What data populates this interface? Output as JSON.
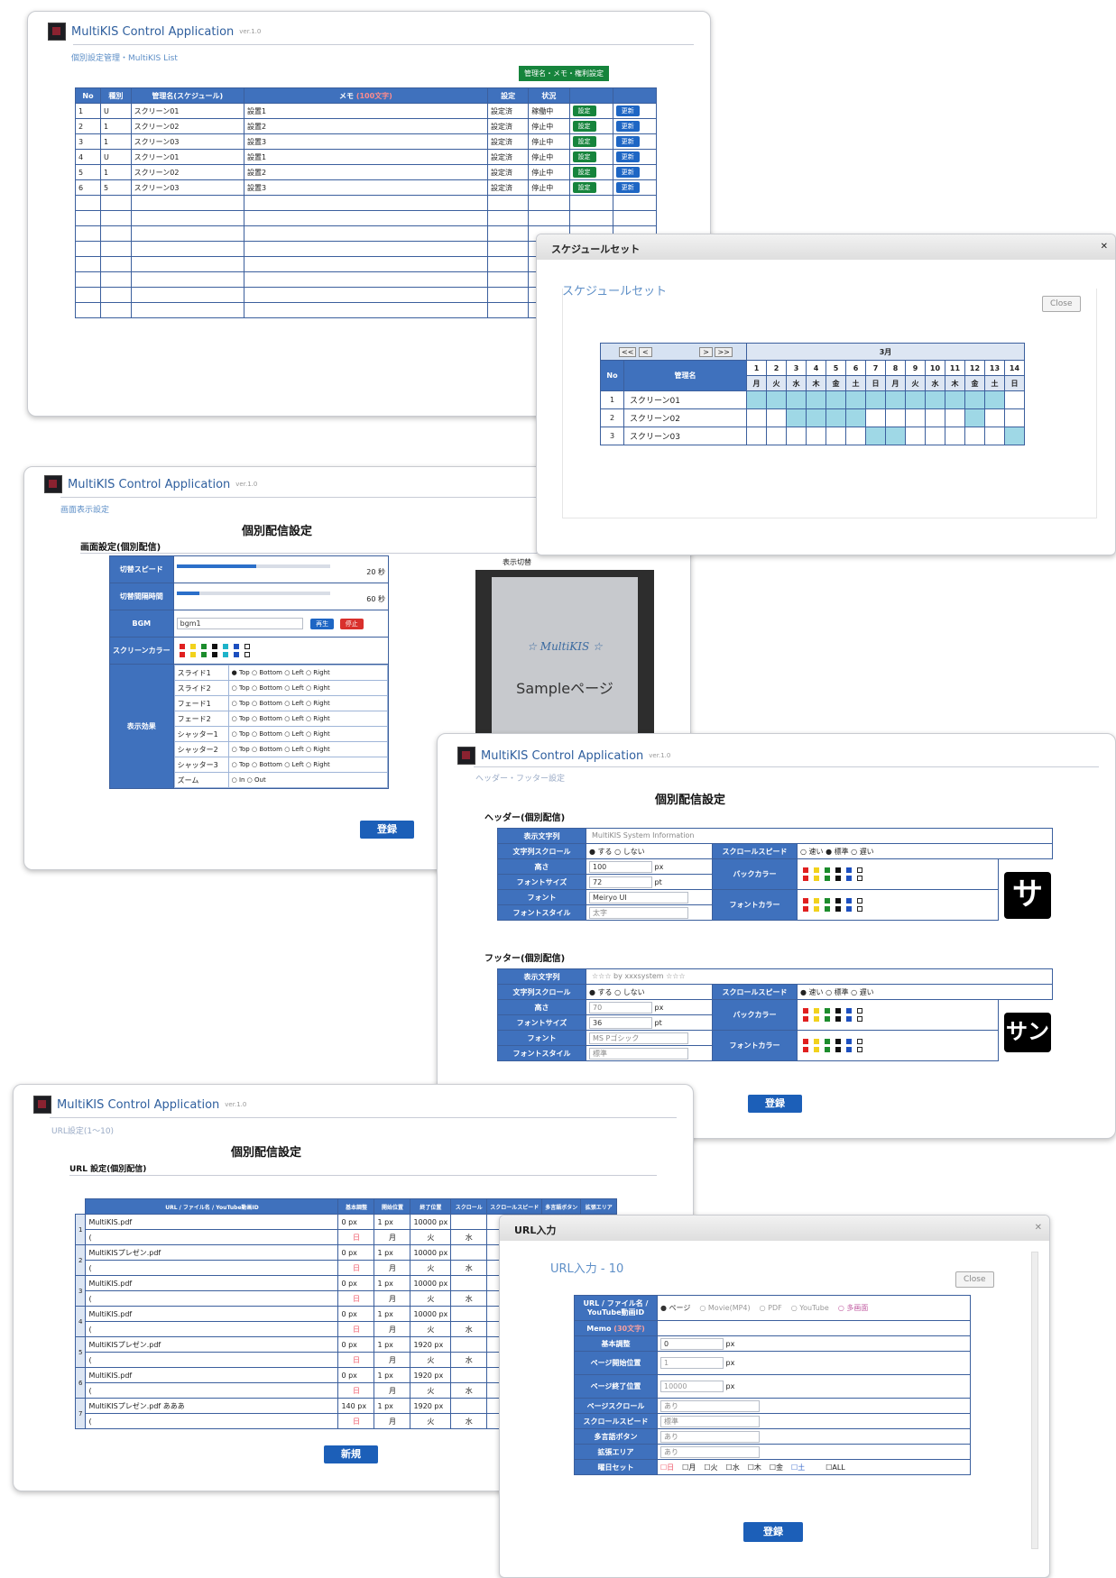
{
  "app": {
    "title": "MultiKIS  Control  Application",
    "version": "ver.1.0"
  },
  "win1": {
    "breadcrumb": "個別設定管理・MultiKIS List",
    "top_button": "管理名・メモ・権利設定",
    "table": {
      "headers": [
        "No",
        "種別",
        "管理名(スケジュール)",
        "メモ",
        "設定",
        "状況",
        "",
        ""
      ],
      "memo_hint": "(100文字)",
      "rows": [
        [
          "1",
          "U",
          "スクリーン01",
          "設置1",
          "設定済",
          "稼働中",
          "設定",
          "更新"
        ],
        [
          "2",
          "1",
          "スクリーン02",
          "設置2",
          "設定済",
          "停止中",
          "設定",
          "更新"
        ],
        [
          "3",
          "1",
          "スクリーン03",
          "設置3",
          "設定済",
          "停止中",
          "設定",
          "更新"
        ],
        [
          "4",
          "U",
          "スクリーン01",
          "設置1",
          "設定済",
          "停止中",
          "設定",
          "更新"
        ],
        [
          "5",
          "1",
          "スクリーン02",
          "設置2",
          "設定済",
          "停止中",
          "設定",
          "更新"
        ],
        [
          "6",
          "5",
          "スクリーン03",
          "設置3",
          "設定済",
          "停止中",
          "設定",
          "更新"
        ]
      ]
    }
  },
  "schedule": {
    "dialog_title": "スケジュールセット",
    "heading": "スケジュールセット",
    "close": "Close",
    "nav": [
      "<<",
      "<",
      ">",
      ">>"
    ],
    "month": "3月",
    "col_no": "No",
    "col_name": "管理名",
    "days": [
      "1",
      "2",
      "3",
      "4",
      "5",
      "6",
      "7",
      "8",
      "9",
      "10",
      "11",
      "12",
      "13",
      "14"
    ],
    "weekdays": [
      "月",
      "火",
      "水",
      "木",
      "金",
      "土",
      "日",
      "月",
      "火",
      "水",
      "木",
      "金",
      "土",
      "日"
    ],
    "rows": [
      {
        "no": "1",
        "name": "スクリーン01",
        "on": [
          1,
          1,
          1,
          1,
          1,
          1,
          1,
          1,
          1,
          1,
          1,
          1,
          1,
          0
        ]
      },
      {
        "no": "2",
        "name": "スクリーン02",
        "on": [
          0,
          0,
          1,
          1,
          1,
          1,
          0,
          0,
          0,
          0,
          0,
          1,
          0,
          0
        ]
      },
      {
        "no": "3",
        "name": "スクリーン03",
        "on": [
          0,
          0,
          0,
          0,
          0,
          0,
          1,
          1,
          0,
          0,
          0,
          0,
          0,
          1
        ]
      }
    ]
  },
  "win2": {
    "breadcrumb": "画面表示設定",
    "heading": "個別配信設定",
    "section": "画面設定(個別配信)",
    "rows": [
      {
        "label": "切替スピード",
        "value": "20 秒"
      },
      {
        "label": "切替間隔時間",
        "value": "60 秒"
      },
      {
        "label": "BGM",
        "field": "bgm1",
        "play": "再生",
        "stop": "停止"
      },
      {
        "label": "スクリーンカラー"
      }
    ],
    "effect_label": "表示効果",
    "effects": [
      "スライド1",
      "スライド2",
      "フェード1",
      "フェード2",
      "シャッター1",
      "シャッター2",
      "シャッター3",
      "ズーム"
    ],
    "directions": [
      "Top",
      "Bottom",
      "Left",
      "Right"
    ],
    "zoom_options": [
      "In",
      "Out"
    ],
    "register": "登録",
    "preview_label": "表示切替",
    "preview_brand": "☆ MultiKIS ☆",
    "preview_text": "Sampleページ"
  },
  "win3": {
    "breadcrumb": "ヘッダー・フッター設定",
    "heading": "個別配信設定",
    "header_section": "ヘッダー(個別配信)",
    "footer_section": "フッター(個別配信)",
    "header": {
      "display_text_label": "表示文字列",
      "display_text": "MultiKIS System Information",
      "scroll_label": "文字列スクロール",
      "scroll_on": "する",
      "scroll_off": "しない",
      "speed_label": "スクロールスピード",
      "speed_opts": [
        "速い",
        "標準",
        "遅い"
      ],
      "height_label": "高さ",
      "height": "100",
      "px": "px",
      "fontsize_label": "フォントサイズ",
      "fontsize": "72",
      "pt": "pt",
      "font_label": "フォント",
      "font": "Meiryo UI",
      "style_label": "フォントスタイル",
      "style": "太字",
      "bg_label": "バックカラー",
      "fc_label": "フォントカラー",
      "sample": "サ"
    },
    "footer": {
      "display_text_label": "表示文字列",
      "display_text": "☆☆☆ by xxxsystem ☆☆☆",
      "scroll_label": "文字列スクロール",
      "scroll_on": "する",
      "scroll_off": "しない",
      "speed_label": "スクロールスピード",
      "speed_opts": [
        "速い",
        "標準",
        "遅い"
      ],
      "height_label": "高さ",
      "height": "70",
      "px": "px",
      "fontsize_label": "フォントサイズ",
      "fontsize": "36",
      "pt": "pt",
      "font_label": "フォント",
      "font": "MS Pゴシック",
      "style_label": "フォントスタイル",
      "style": "標準",
      "bg_label": "バックカラー",
      "fc_label": "フォントカラー",
      "sample": "サン"
    },
    "register": "登録"
  },
  "win4": {
    "breadcrumb": "URL設定(1～10)",
    "heading": "個別配信設定",
    "section": "URL 設定(個別配信)",
    "headers": [
      "URL / ファイル名 / YouTube動画ID",
      "基本調整",
      "開始位置",
      "終了位置",
      "スクロール",
      "スクロールスピード",
      "多言語ボタン",
      "拡張エリア"
    ],
    "rows": [
      {
        "no": "1",
        "name": "MultiKIS.pdf",
        "a": "0 px",
        "b": "1 px",
        "c": "10000 px"
      },
      {
        "no": "2",
        "name": "MultiKISプレゼン.pdf",
        "a": "0 px",
        "b": "1 px",
        "c": "10000 px"
      },
      {
        "no": "3",
        "name": "MultiKIS.pdf",
        "a": "0 px",
        "b": "1 px",
        "c": "10000 px"
      },
      {
        "no": "4",
        "name": "MultiKIS.pdf",
        "a": "0 px",
        "b": "1 px",
        "c": "10000 px"
      },
      {
        "no": "5",
        "name": "MultiKISプレゼン.pdf",
        "a": "0 px",
        "b": "1 px",
        "c": "1920 px"
      },
      {
        "no": "6",
        "name": "MultiKIS.pdf",
        "a": "0 px",
        "b": "1 px",
        "c": "1920 px"
      },
      {
        "no": "7",
        "name": "MultiKISプレゼン.pdf  あああ",
        "a": "140 px",
        "b": "1 px",
        "c": "1920 px"
      }
    ],
    "sub_days": [
      "日",
      "月",
      "火",
      "水",
      "木"
    ],
    "new_button": "新規"
  },
  "url": {
    "dialog_title": "URL入力",
    "heading": "URL入力 - 10",
    "close": "Close",
    "type_label": "URL / ファイル名 / YouTube動画ID",
    "types": [
      "ページ",
      "Movie(MP4)",
      "PDF",
      "YouTube",
      "多画面"
    ],
    "memo_label": "Memo",
    "memo_hint": "(30文字)",
    "base_label": "基本調整",
    "base": "0",
    "px": "px",
    "start_label": "ページ開始位置",
    "start": "1",
    "end_label": "ページ終了位置",
    "end": "10000",
    "scroll_label": "ページスクロール",
    "scroll": "あり",
    "speed_label": "スクロールスピード",
    "speed": "標準",
    "lang_label": "多言語ボタン",
    "lang": "あり",
    "ext_label": "拡張エリア",
    "ext": "あり",
    "days_label": "曜日セット",
    "days": [
      "日",
      "月",
      "火",
      "水",
      "木",
      "金",
      "土",
      "ALL"
    ],
    "register": "登録"
  },
  "colors": {
    "accent": "#3f71bd",
    "green": "#16843c",
    "blue_btn": "#1e66c4",
    "highlight": "#9fd8e6"
  }
}
